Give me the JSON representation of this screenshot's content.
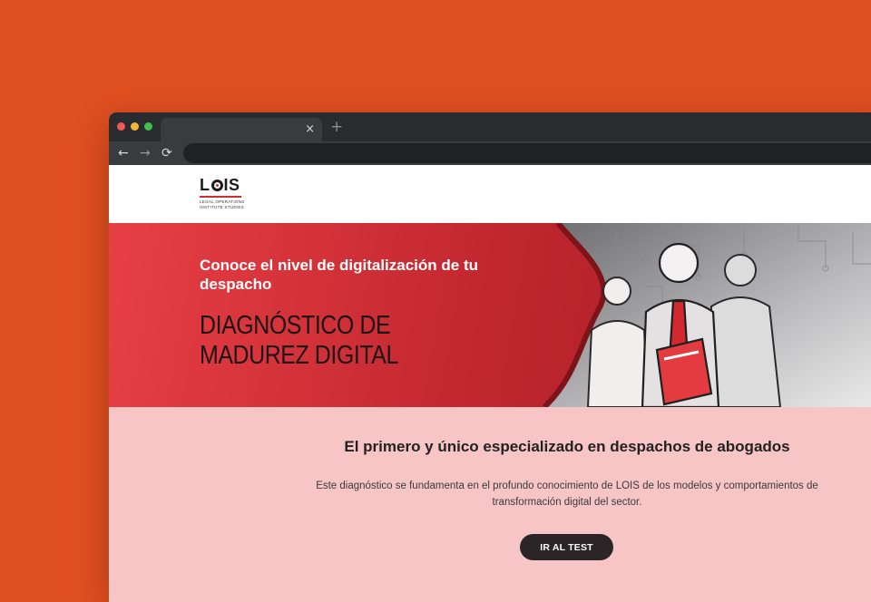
{
  "browser": {
    "tab_close_glyph": "×",
    "new_tab_glyph": "+",
    "back_glyph": "←",
    "forward_glyph": "→",
    "reload_glyph": "⟳",
    "address": ""
  },
  "header": {
    "logo_word_l": "L",
    "logo_word_is": "IS",
    "logo_sub_line1": "LEGAL OPERATIONS",
    "logo_sub_line2": "INSTITUTE STUDIES"
  },
  "hero": {
    "subtitle": "Conoce el nivel de digitalización de tu despacho",
    "title": "DIAGNÓSTICO DE MADUREZ DIGITAL"
  },
  "content": {
    "title": "El primero y único especializado en despachos de abogados",
    "description": "Este diagnóstico se fundamenta en el profundo conocimiento de LOIS de los modelos y comportamientos de transformación digital del sector.",
    "cta_label": "IR AL TEST"
  },
  "colors": {
    "background": "#e04f20",
    "hero_red": "#c0262e",
    "content_pink": "#f7c5c6",
    "button_dark": "#2b2527"
  },
  "icons": [
    "close-icon",
    "plus-icon",
    "back-arrow-icon",
    "forward-arrow-icon",
    "reload-icon",
    "lois-logo",
    "business-people-illustration"
  ]
}
